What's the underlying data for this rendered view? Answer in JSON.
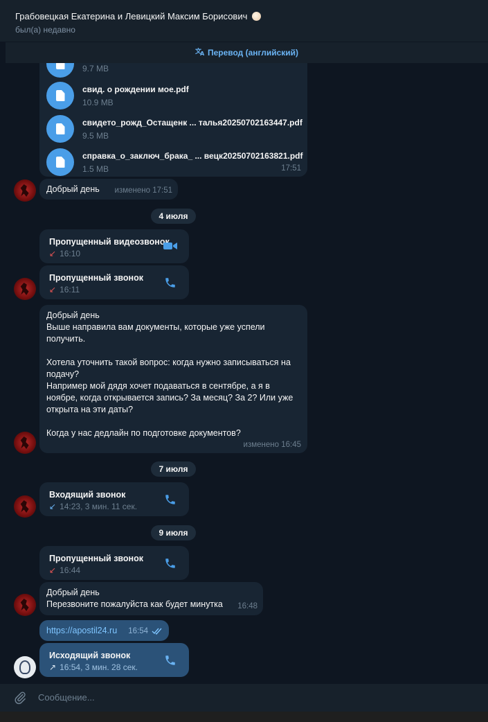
{
  "header": {
    "title": "Грабовецкая Екатерина и Левицкий Максим Борисович",
    "status": "был(а) недавно"
  },
  "translate_bar": {
    "icon": "translate-icon",
    "label": "Перевод (английский)"
  },
  "files": [
    {
      "name": "",
      "size": "9.7 MB"
    },
    {
      "name": "свид. о рождении мое.pdf",
      "size": "10.9 MB"
    },
    {
      "name": "свидето_рожд_Остащенк ... талья20250702163447.pdf",
      "size": "9.5 MB"
    },
    {
      "name": "справка_о_заключ_брака_ ...  вецк20250702163821.pdf",
      "size": "1.5 MB"
    }
  ],
  "files_time": "17:51",
  "msg1": {
    "text": "Добрый день",
    "time": "изменено 17:51"
  },
  "dates": {
    "d1": "4 июля",
    "d2": "7 июля",
    "d3": "9 июля"
  },
  "call1": {
    "title": "Пропущенный видеозвонок",
    "time": "16:10",
    "icon": "video-camera-icon"
  },
  "call2": {
    "title": "Пропущенный звонок",
    "time": "16:11",
    "icon": "phone-icon"
  },
  "msg2": {
    "text": "Добрый день\nВыше направила вам документы, которые уже успели\nполучить.\n\nХотела уточнить такой вопрос: когда нужно записываться на\nподачу?\nНапример мой дядя хочет подаваться в сентябре, а я в\nноябре, когда открывается запись? За месяц? За 2? Или уже\nоткрыта на эти даты?\n\nКогда у нас дедлайн по подготовке документов?",
    "time": "изменено 16:45"
  },
  "call3": {
    "title": "Входящий звонок",
    "time": "14:23, 3 мин. 11 сек."
  },
  "call4": {
    "title": "Пропущенный звонок",
    "time": "16:44"
  },
  "msg3": {
    "text": "Добрый день\nПерезвоните пожалуйста как будет минутка",
    "time": "16:48"
  },
  "msg4": {
    "link": "https://apostil24.ru",
    "time": "16:54"
  },
  "call5": {
    "title": "Исходящий звонок",
    "time": "16:54, 3 мин. 28 сек."
  },
  "composer": {
    "placeholder": "Сообщение..."
  },
  "colors": {
    "background": "#0e1621",
    "incoming": "#182533",
    "outgoing": "#2b5278",
    "accent": "#4a9ee8",
    "missed": "#e05454"
  }
}
